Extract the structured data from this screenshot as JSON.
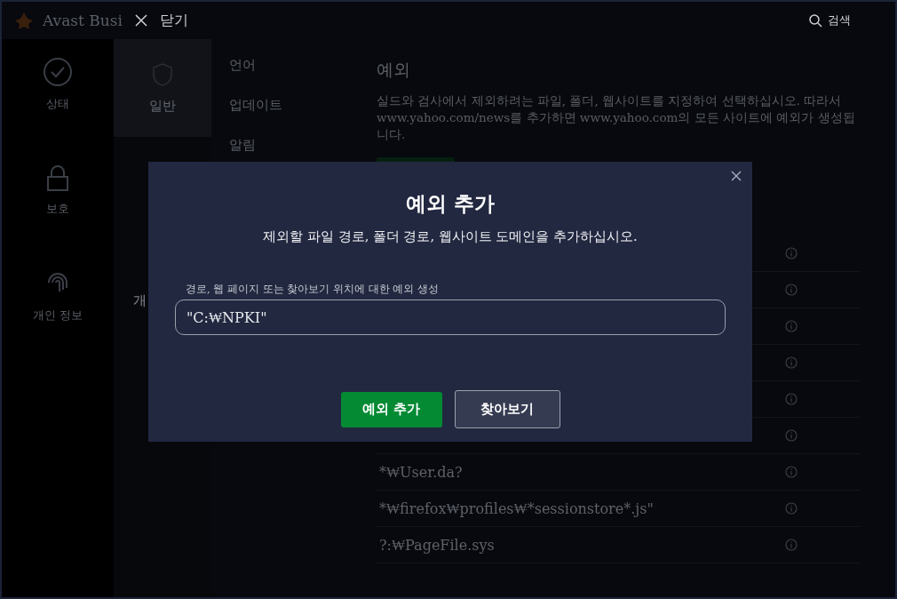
{
  "titlebar": {
    "app_name": "Avast Busi",
    "close_label": "닫기",
    "search_label": "검색"
  },
  "sidebar": {
    "items": [
      {
        "label": "상태",
        "selected": false
      },
      {
        "label": "보호",
        "selected": false
      },
      {
        "label": "개인 정보",
        "selected": false
      }
    ]
  },
  "categories": {
    "items": [
      {
        "label": "일반",
        "selected": true
      },
      {
        "label": "개",
        "selected": false
      }
    ]
  },
  "subnav": {
    "items": [
      {
        "label": "언어"
      },
      {
        "label": "업데이트"
      },
      {
        "label": "알림"
      }
    ]
  },
  "content": {
    "title": "예외",
    "description": "실드와 검사에서 제외하려는 파일, 폴더, 웹사이트를 지정하여 선택하십시오. 따라서 www.yahoo.com/news를 추가하면 www.yahoo.com의 모든 사이트에 예외가 생성됩니다.",
    "rows": [
      {
        "kind": "covered"
      },
      {
        "kind": "covered"
      },
      {
        "kind": "covered"
      },
      {
        "kind": "covered"
      },
      {
        "kind": "covered"
      },
      {
        "kind": "covered"
      },
      {
        "kind": "entry",
        "path": "*₩User.da?"
      },
      {
        "kind": "entry",
        "path": "*₩firefox₩profiles₩*sessionstore*.js\""
      },
      {
        "kind": "entry",
        "path": "?:₩PageFile.sys"
      }
    ]
  },
  "dialog": {
    "title": "예외 추가",
    "subtitle": "제외할 파일 경로, 폴더 경로, 웹사이트 도메인을 추가하십시오.",
    "field_label": "경로, 웹 페이지 또는 찾아보기 위치에 대한 예외 생성",
    "field_value": "\"C:₩NPKI\"",
    "buttons": [
      {
        "label": "예외 추가",
        "kind": "primary"
      },
      {
        "label": "찾아보기",
        "kind": "secondary"
      }
    ]
  }
}
